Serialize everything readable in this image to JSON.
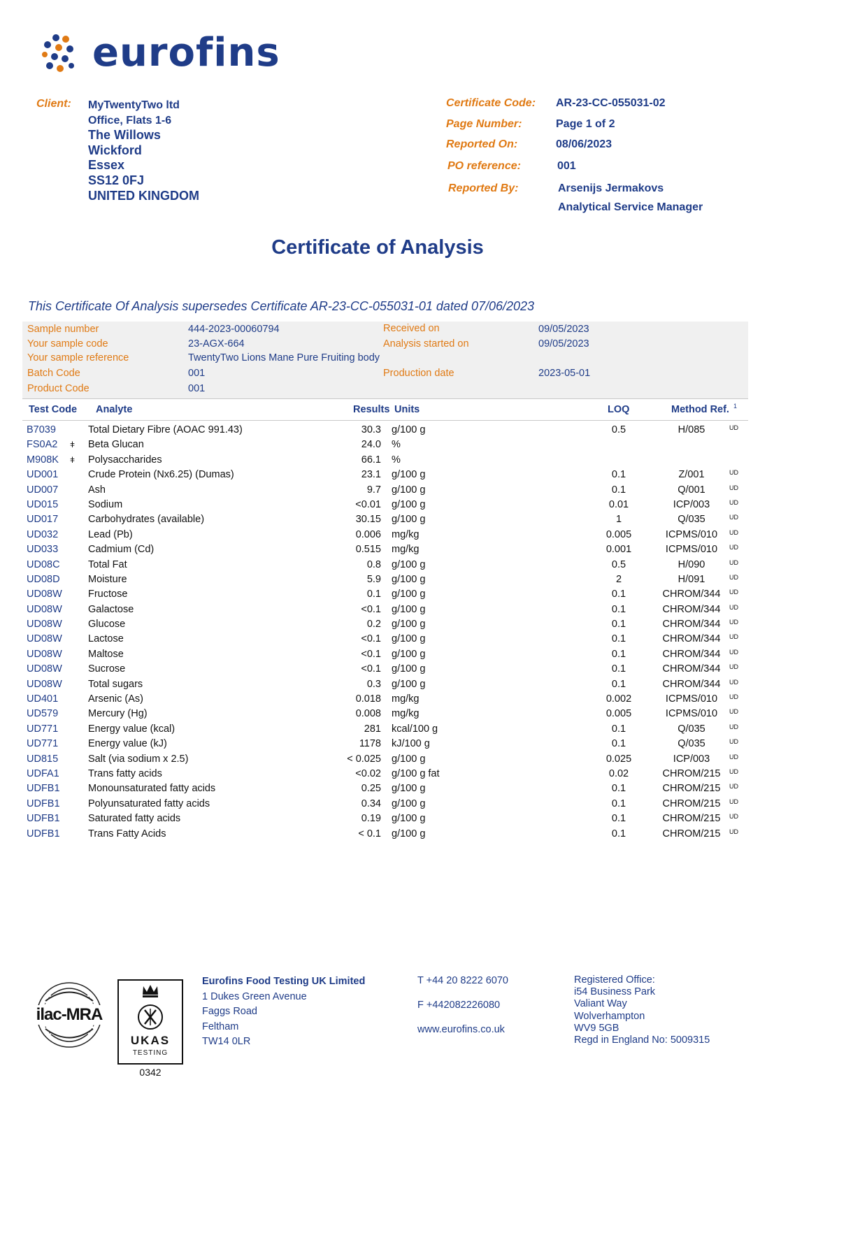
{
  "brand": {
    "name": "eurofins",
    "color": "#1f3c88",
    "accent": "#e07a14"
  },
  "client": {
    "label": "Client:",
    "lines": [
      "MyTwentyTwo ltd",
      "Office, Flats 1-6",
      "The Willows",
      "Wickford",
      "Essex",
      "SS12 0FJ",
      "UNITED KINGDOM"
    ]
  },
  "report": {
    "certificate_code_label": "Certificate Code:",
    "certificate_code": "AR-23-CC-055031-02",
    "page_number_label": "Page Number:",
    "page_number": "Page 1 of 2",
    "reported_on_label": "Reported On:",
    "reported_on": "08/06/2023",
    "po_reference_label": "PO reference:",
    "po_reference": "001",
    "reported_by_label": "Reported By:",
    "reported_by_name": "Arsenijs Jermakovs",
    "reported_by_role": "Analytical Service Manager"
  },
  "title": "Certificate of Analysis",
  "supersedes": "This Certificate Of Analysis supersedes Certificate AR-23-CC-055031-01 dated 07/06/2023",
  "sample": {
    "sample_number_label": "Sample number",
    "sample_number": "444-2023-00060794",
    "your_sample_code_label": "Your sample code",
    "your_sample_code": "23-AGX-664",
    "your_sample_reference_label": "Your sample reference",
    "your_sample_reference": "TwentyTwo Lions Mane Pure Fruiting body",
    "batch_code_label": "Batch Code",
    "batch_code": "001",
    "product_code_label": "Product Code",
    "product_code": "001",
    "received_on_label": "Received on",
    "received_on": "09/05/2023",
    "analysis_started_label": "Analysis started on",
    "analysis_started": "09/05/2023",
    "production_date_label": "Production date",
    "production_date": "2023-05-01"
  },
  "table": {
    "headers": {
      "test_code": "Test Code",
      "analyte": "Analyte",
      "results": "Results",
      "units": "Units",
      "loq": "LOQ",
      "method": "Method Ref.",
      "method_sup": "1"
    },
    "rows": [
      {
        "code": "B7039",
        "mark": "",
        "analyte": "Total Dietary Fibre (AOAC 991.43)",
        "result": "30.3",
        "unit": "g/100 g",
        "loq": "0.5",
        "method": "H/085",
        "flag": "UD"
      },
      {
        "code": "FS0A2",
        "mark": "ǂ",
        "analyte": "Beta Glucan",
        "result": "24.0",
        "unit": "%",
        "loq": "",
        "method": "",
        "flag": ""
      },
      {
        "code": "M908K",
        "mark": "ǂ",
        "analyte": "Polysaccharides",
        "result": "66.1",
        "unit": "%",
        "loq": "",
        "method": "",
        "flag": ""
      },
      {
        "code": "UD001",
        "mark": "",
        "analyte": "Crude Protein (Nx6.25) (Dumas)",
        "result": "23.1",
        "unit": "g/100 g",
        "loq": "0.1",
        "method": "Z/001",
        "flag": "UD"
      },
      {
        "code": "UD007",
        "mark": "",
        "analyte": "Ash",
        "result": "9.7",
        "unit": "g/100 g",
        "loq": "0.1",
        "method": "Q/001",
        "flag": "UD"
      },
      {
        "code": "UD015",
        "mark": "",
        "analyte": "Sodium",
        "result": "<0.01",
        "unit": "g/100 g",
        "loq": "0.01",
        "method": "ICP/003",
        "flag": "UD"
      },
      {
        "code": "UD017",
        "mark": "",
        "analyte": "Carbohydrates (available)",
        "result": "30.15",
        "unit": "g/100 g",
        "loq": "1",
        "method": "Q/035",
        "flag": "UD"
      },
      {
        "code": "UD032",
        "mark": "",
        "analyte": "Lead (Pb)",
        "result": "0.006",
        "unit": "mg/kg",
        "loq": "0.005",
        "method": "ICPMS/010",
        "flag": "UD"
      },
      {
        "code": "UD033",
        "mark": "",
        "analyte": "Cadmium (Cd)",
        "result": "0.515",
        "unit": "mg/kg",
        "loq": "0.001",
        "method": "ICPMS/010",
        "flag": "UD"
      },
      {
        "code": "UD08C",
        "mark": "",
        "analyte": "Total Fat",
        "result": "0.8",
        "unit": "g/100 g",
        "loq": "0.5",
        "method": "H/090",
        "flag": "UD"
      },
      {
        "code": "UD08D",
        "mark": "",
        "analyte": "Moisture",
        "result": "5.9",
        "unit": "g/100 g",
        "loq": "2",
        "method": "H/091",
        "flag": "UD"
      },
      {
        "code": "UD08W",
        "mark": "",
        "analyte": "Fructose",
        "result": "0.1",
        "unit": "g/100 g",
        "loq": "0.1",
        "method": "CHROM/344",
        "flag": "UD"
      },
      {
        "code": "UD08W",
        "mark": "",
        "analyte": "Galactose",
        "result": "<0.1",
        "unit": "g/100 g",
        "loq": "0.1",
        "method": "CHROM/344",
        "flag": "UD"
      },
      {
        "code": "UD08W",
        "mark": "",
        "analyte": "Glucose",
        "result": "0.2",
        "unit": "g/100 g",
        "loq": "0.1",
        "method": "CHROM/344",
        "flag": "UD"
      },
      {
        "code": "UD08W",
        "mark": "",
        "analyte": "Lactose",
        "result": "<0.1",
        "unit": "g/100 g",
        "loq": "0.1",
        "method": "CHROM/344",
        "flag": "UD"
      },
      {
        "code": "UD08W",
        "mark": "",
        "analyte": "Maltose",
        "result": "<0.1",
        "unit": "g/100 g",
        "loq": "0.1",
        "method": "CHROM/344",
        "flag": "UD"
      },
      {
        "code": "UD08W",
        "mark": "",
        "analyte": "Sucrose",
        "result": "<0.1",
        "unit": "g/100 g",
        "loq": "0.1",
        "method": "CHROM/344",
        "flag": "UD"
      },
      {
        "code": "UD08W",
        "mark": "",
        "analyte": "Total sugars",
        "result": "0.3",
        "unit": "g/100 g",
        "loq": "0.1",
        "method": "CHROM/344",
        "flag": "UD"
      },
      {
        "code": "UD401",
        "mark": "",
        "analyte": "Arsenic (As)",
        "result": "0.018",
        "unit": "mg/kg",
        "loq": "0.002",
        "method": "ICPMS/010",
        "flag": "UD"
      },
      {
        "code": "UD579",
        "mark": "",
        "analyte": "Mercury (Hg)",
        "result": "0.008",
        "unit": "mg/kg",
        "loq": "0.005",
        "method": "ICPMS/010",
        "flag": "UD"
      },
      {
        "code": "UD771",
        "mark": "",
        "analyte": "Energy value (kcal)",
        "result": "281",
        "unit": "kcal/100 g",
        "loq": "0.1",
        "method": "Q/035",
        "flag": "UD"
      },
      {
        "code": "UD771",
        "mark": "",
        "analyte": "Energy value (kJ)",
        "result": "1178",
        "unit": "kJ/100 g",
        "loq": "0.1",
        "method": "Q/035",
        "flag": "UD"
      },
      {
        "code": "UD815",
        "mark": "",
        "analyte": "Salt (via sodium x 2.5)",
        "result": "< 0.025",
        "unit": "g/100 g",
        "loq": "0.025",
        "method": "ICP/003",
        "flag": "UD"
      },
      {
        "code": "UDFA1",
        "mark": "",
        "analyte": "Trans fatty acids",
        "result": "<0.02",
        "unit": "g/100 g fat",
        "loq": "0.02",
        "method": "CHROM/215",
        "flag": "UD"
      },
      {
        "code": "UDFB1",
        "mark": "",
        "analyte": "Monounsaturated fatty acids",
        "result": "0.25",
        "unit": "g/100 g",
        "loq": "0.1",
        "method": "CHROM/215",
        "flag": "UD"
      },
      {
        "code": "UDFB1",
        "mark": "",
        "analyte": "Polyunsaturated fatty acids",
        "result": "0.34",
        "unit": "g/100 g",
        "loq": "0.1",
        "method": "CHROM/215",
        "flag": "UD"
      },
      {
        "code": "UDFB1",
        "mark": "",
        "analyte": "Saturated fatty acids",
        "result": "0.19",
        "unit": "g/100 g",
        "loq": "0.1",
        "method": "CHROM/215",
        "flag": "UD"
      },
      {
        "code": "UDFB1",
        "mark": "",
        "analyte": "Trans Fatty Acids",
        "result": "< 0.1",
        "unit": "g/100 g",
        "loq": "0.1",
        "method": "CHROM/215",
        "flag": "UD"
      }
    ]
  },
  "footer": {
    "ilac_logo_text": "ilac-MRA",
    "ukas_logo_text": "UKAS",
    "ukas_sub": "TESTING",
    "ukas_number": "0342",
    "company": [
      "Eurofins Food Testing UK Limited",
      "1 Dukes Green Avenue",
      "Faggs Road",
      "Feltham",
      "TW14 0LR"
    ],
    "phone": "T  +44 20 8222 6070",
    "fax": "F  +442082226080",
    "web": "www.eurofins.co.uk",
    "registered": [
      "Registered Office:",
      "i54 Business Park",
      "Valiant Way",
      "Wolverhampton",
      "WV9 5GB",
      "Regd in England No: 5009315"
    ]
  }
}
